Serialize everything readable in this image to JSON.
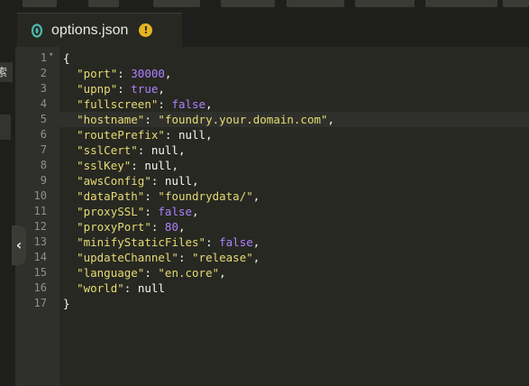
{
  "tab": {
    "filename": "options.json",
    "warning_glyph": "!"
  },
  "sidebar": {
    "tab_label": "索"
  },
  "collapse_glyph": "‹",
  "line_numbers": [
    "1",
    "2",
    "3",
    "4",
    "5",
    "6",
    "7",
    "8",
    "9",
    "10",
    "11",
    "12",
    "13",
    "14",
    "15",
    "16",
    "17"
  ],
  "active_line": 5,
  "code_lines": [
    [
      {
        "t": "punc",
        "v": "{"
      }
    ],
    [
      {
        "t": "punc",
        "v": "  "
      },
      {
        "t": "key",
        "v": "\"port\""
      },
      {
        "t": "punc",
        "v": ": "
      },
      {
        "t": "num",
        "v": "30000"
      },
      {
        "t": "punc",
        "v": ","
      }
    ],
    [
      {
        "t": "punc",
        "v": "  "
      },
      {
        "t": "key",
        "v": "\"upnp\""
      },
      {
        "t": "punc",
        "v": ": "
      },
      {
        "t": "bool",
        "v": "true"
      },
      {
        "t": "punc",
        "v": ","
      }
    ],
    [
      {
        "t": "punc",
        "v": "  "
      },
      {
        "t": "key",
        "v": "\"fullscreen\""
      },
      {
        "t": "punc",
        "v": ": "
      },
      {
        "t": "bool",
        "v": "false"
      },
      {
        "t": "punc",
        "v": ","
      }
    ],
    [
      {
        "t": "punc",
        "v": "  "
      },
      {
        "t": "key",
        "v": "\"hostname\""
      },
      {
        "t": "punc",
        "v": ": "
      },
      {
        "t": "str",
        "v": "\"foundry.your.domain.com\""
      },
      {
        "t": "punc",
        "v": ","
      }
    ],
    [
      {
        "t": "punc",
        "v": "  "
      },
      {
        "t": "key",
        "v": "\"routePrefix\""
      },
      {
        "t": "punc",
        "v": ": "
      },
      {
        "t": "null",
        "v": "null"
      },
      {
        "t": "punc",
        "v": ","
      }
    ],
    [
      {
        "t": "punc",
        "v": "  "
      },
      {
        "t": "key",
        "v": "\"sslCert\""
      },
      {
        "t": "punc",
        "v": ": "
      },
      {
        "t": "null",
        "v": "null"
      },
      {
        "t": "punc",
        "v": ","
      }
    ],
    [
      {
        "t": "punc",
        "v": "  "
      },
      {
        "t": "key",
        "v": "\"sslKey\""
      },
      {
        "t": "punc",
        "v": ": "
      },
      {
        "t": "null",
        "v": "null"
      },
      {
        "t": "punc",
        "v": ","
      }
    ],
    [
      {
        "t": "punc",
        "v": "  "
      },
      {
        "t": "key",
        "v": "\"awsConfig\""
      },
      {
        "t": "punc",
        "v": ": "
      },
      {
        "t": "null",
        "v": "null"
      },
      {
        "t": "punc",
        "v": ","
      }
    ],
    [
      {
        "t": "punc",
        "v": "  "
      },
      {
        "t": "key",
        "v": "\"dataPath\""
      },
      {
        "t": "punc",
        "v": ": "
      },
      {
        "t": "str",
        "v": "\"foundrydata/\""
      },
      {
        "t": "punc",
        "v": ","
      }
    ],
    [
      {
        "t": "punc",
        "v": "  "
      },
      {
        "t": "key",
        "v": "\"proxySSL\""
      },
      {
        "t": "punc",
        "v": ": "
      },
      {
        "t": "bool",
        "v": "false"
      },
      {
        "t": "punc",
        "v": ","
      }
    ],
    [
      {
        "t": "punc",
        "v": "  "
      },
      {
        "t": "key",
        "v": "\"proxyPort\""
      },
      {
        "t": "punc",
        "v": ": "
      },
      {
        "t": "num",
        "v": "80"
      },
      {
        "t": "punc",
        "v": ","
      }
    ],
    [
      {
        "t": "punc",
        "v": "  "
      },
      {
        "t": "key",
        "v": "\"minifyStaticFiles\""
      },
      {
        "t": "punc",
        "v": ": "
      },
      {
        "t": "bool",
        "v": "false"
      },
      {
        "t": "punc",
        "v": ","
      }
    ],
    [
      {
        "t": "punc",
        "v": "  "
      },
      {
        "t": "key",
        "v": "\"updateChannel\""
      },
      {
        "t": "punc",
        "v": ": "
      },
      {
        "t": "str",
        "v": "\"release\""
      },
      {
        "t": "punc",
        "v": ","
      }
    ],
    [
      {
        "t": "punc",
        "v": "  "
      },
      {
        "t": "key",
        "v": "\"language\""
      },
      {
        "t": "punc",
        "v": ": "
      },
      {
        "t": "str",
        "v": "\"en.core\""
      },
      {
        "t": "punc",
        "v": ","
      }
    ],
    [
      {
        "t": "punc",
        "v": "  "
      },
      {
        "t": "key",
        "v": "\"world\""
      },
      {
        "t": "punc",
        "v": ": "
      },
      {
        "t": "null",
        "v": "null"
      }
    ],
    [
      {
        "t": "punc",
        "v": "}"
      }
    ]
  ],
  "colors": {
    "editor_bg": "#272822",
    "gutter_bg": "#2f302b",
    "string": "#e6db74",
    "number": "#ae81ff",
    "text": "#f8f8f2",
    "line_number": "#8f908a",
    "warning": "#e6b422",
    "file_icon": "#4db6ac"
  }
}
